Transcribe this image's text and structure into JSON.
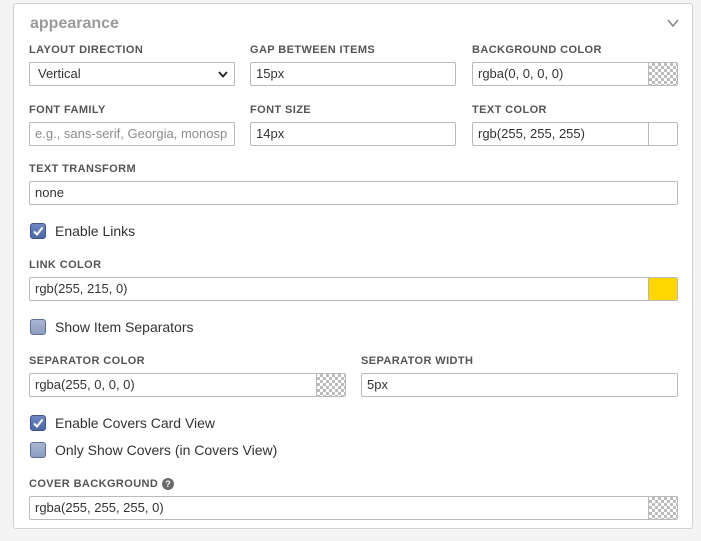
{
  "panel": {
    "title": "appearance"
  },
  "fields": {
    "layout_direction": {
      "label": "LAYOUT DIRECTION",
      "value": "Vertical"
    },
    "gap_between_items": {
      "label": "GAP BETWEEN ITEMS",
      "value": "15px"
    },
    "background_color": {
      "label": "BACKGROUND COLOR",
      "value": "rgba(0, 0, 0, 0)"
    },
    "font_family": {
      "label": "FONT FAMILY",
      "placeholder": "e.g., sans-serif, Georgia, monosp"
    },
    "font_size": {
      "label": "FONT SIZE",
      "value": "14px"
    },
    "text_color": {
      "label": "TEXT COLOR",
      "value": "rgb(255, 255, 255)",
      "swatch": "#ffffff"
    },
    "text_transform": {
      "label": "TEXT TRANSFORM",
      "value": "none"
    },
    "link_color": {
      "label": "LINK COLOR",
      "value": "rgb(255, 215, 0)",
      "swatch": "#ffd700"
    },
    "separator_color": {
      "label": "SEPARATOR COLOR",
      "value": "rgba(255, 0, 0, 0)"
    },
    "separator_width": {
      "label": "SEPARATOR WIDTH",
      "value": "5px"
    },
    "cover_background": {
      "label": "COVER BACKGROUND",
      "value": "rgba(255, 255, 255, 0)",
      "help": "?"
    }
  },
  "checkboxes": {
    "enable_links": {
      "label": "Enable Links",
      "checked": true
    },
    "show_item_separators": {
      "label": "Show Item Separators",
      "checked": false
    },
    "enable_covers_card_view": {
      "label": "Enable Covers Card View",
      "checked": true
    },
    "only_show_covers": {
      "label": "Only Show Covers (in Covers View)",
      "checked": false
    }
  }
}
